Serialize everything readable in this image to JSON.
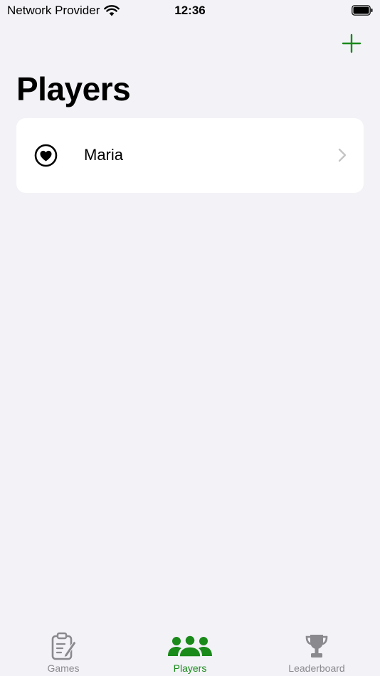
{
  "status_bar": {
    "carrier": "Network Provider",
    "time": "12:36",
    "wifi_icon": "wifi-icon",
    "battery_icon": "battery-icon"
  },
  "nav": {
    "add_icon": "plus-icon"
  },
  "page": {
    "title": "Players"
  },
  "players": [
    {
      "name": "Maria",
      "icon": "heart-circle-icon",
      "disclosure_icon": "chevron-right-icon"
    }
  ],
  "tab_bar": {
    "tabs": [
      {
        "label": "Games",
        "icon": "clipboard-edit-icon",
        "active": false
      },
      {
        "label": "Players",
        "icon": "people-group-icon",
        "active": true
      },
      {
        "label": "Leaderboard",
        "icon": "trophy-icon",
        "active": false
      }
    ]
  },
  "colors": {
    "accent": "#1a8a1a",
    "inactive": "#8a8a8e",
    "background": "#f2f2f7",
    "card": "#ffffff"
  }
}
